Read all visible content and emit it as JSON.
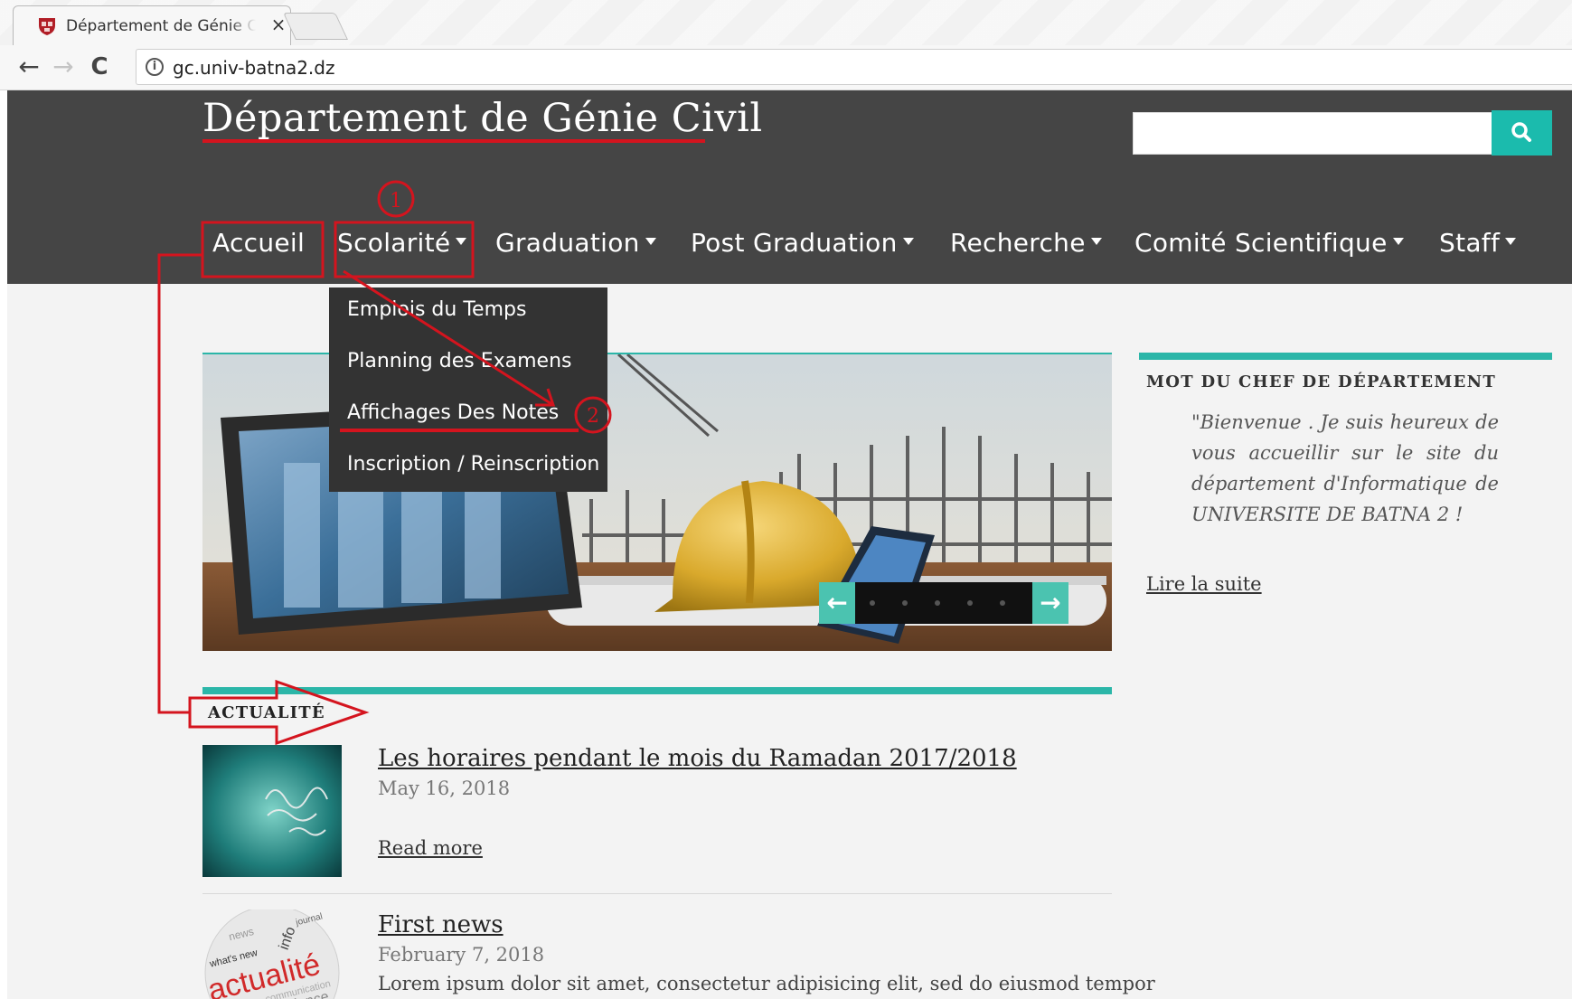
{
  "browser": {
    "tab_title": "Département de Génie Civil",
    "tab_close": "×",
    "url": "gc.univ-batna2.dz",
    "info_glyph": "i",
    "back_glyph": "←",
    "forward_glyph": "→",
    "reload_glyph": "C"
  },
  "site": {
    "title": "Département de Génie Civil",
    "search": {
      "placeholder": ""
    }
  },
  "nav": {
    "items": [
      {
        "label": "Accueil"
      },
      {
        "label": "Scolarité"
      },
      {
        "label": "Graduation"
      },
      {
        "label": "Post Graduation"
      },
      {
        "label": "Recherche"
      },
      {
        "label": "Comité Scientifique"
      },
      {
        "label": "Staff"
      }
    ]
  },
  "dropdown": {
    "items": [
      {
        "label": "Emplois du Temps"
      },
      {
        "label": "Planning des Examens"
      },
      {
        "label": "Affichages Des Notes"
      },
      {
        "label": "Inscription / Reinscription"
      }
    ]
  },
  "slider": {
    "prev_glyph": "←",
    "next_glyph": "→",
    "slide_count": 5
  },
  "sidebar": {
    "heading": "MOT DU CHEF DE DÉPARTEMENT",
    "welcome_text": "\"Bienvenue . Je suis heureux de vous accueillir sur le site du département d'Informatique de UNIVERSITE DE BATNA 2 !",
    "read_more": "Lire la suite"
  },
  "news": {
    "heading": "ACTUALITÉ",
    "items": [
      {
        "title": "Les horaires pendant le mois du Ramadan 2017/2018",
        "date": "May 16, 2018",
        "read_more": "Read more"
      },
      {
        "title": "First news",
        "date": "February 7, 2018",
        "excerpt": "Lorem ipsum dolor sit amet, consectetur adipisicing elit, sed do eiusmod tempor"
      }
    ]
  },
  "thumb2_words": [
    "actualité",
    "what's new",
    "info",
    "news",
    "communication",
    "dance",
    "journal"
  ],
  "annotations": {
    "step1": "1",
    "step2": "2"
  },
  "colors": {
    "header_bg": "#454545",
    "accent_teal": "#2bb6a8",
    "annotation_red": "#d4141e",
    "dropdown_bg": "#333333"
  }
}
